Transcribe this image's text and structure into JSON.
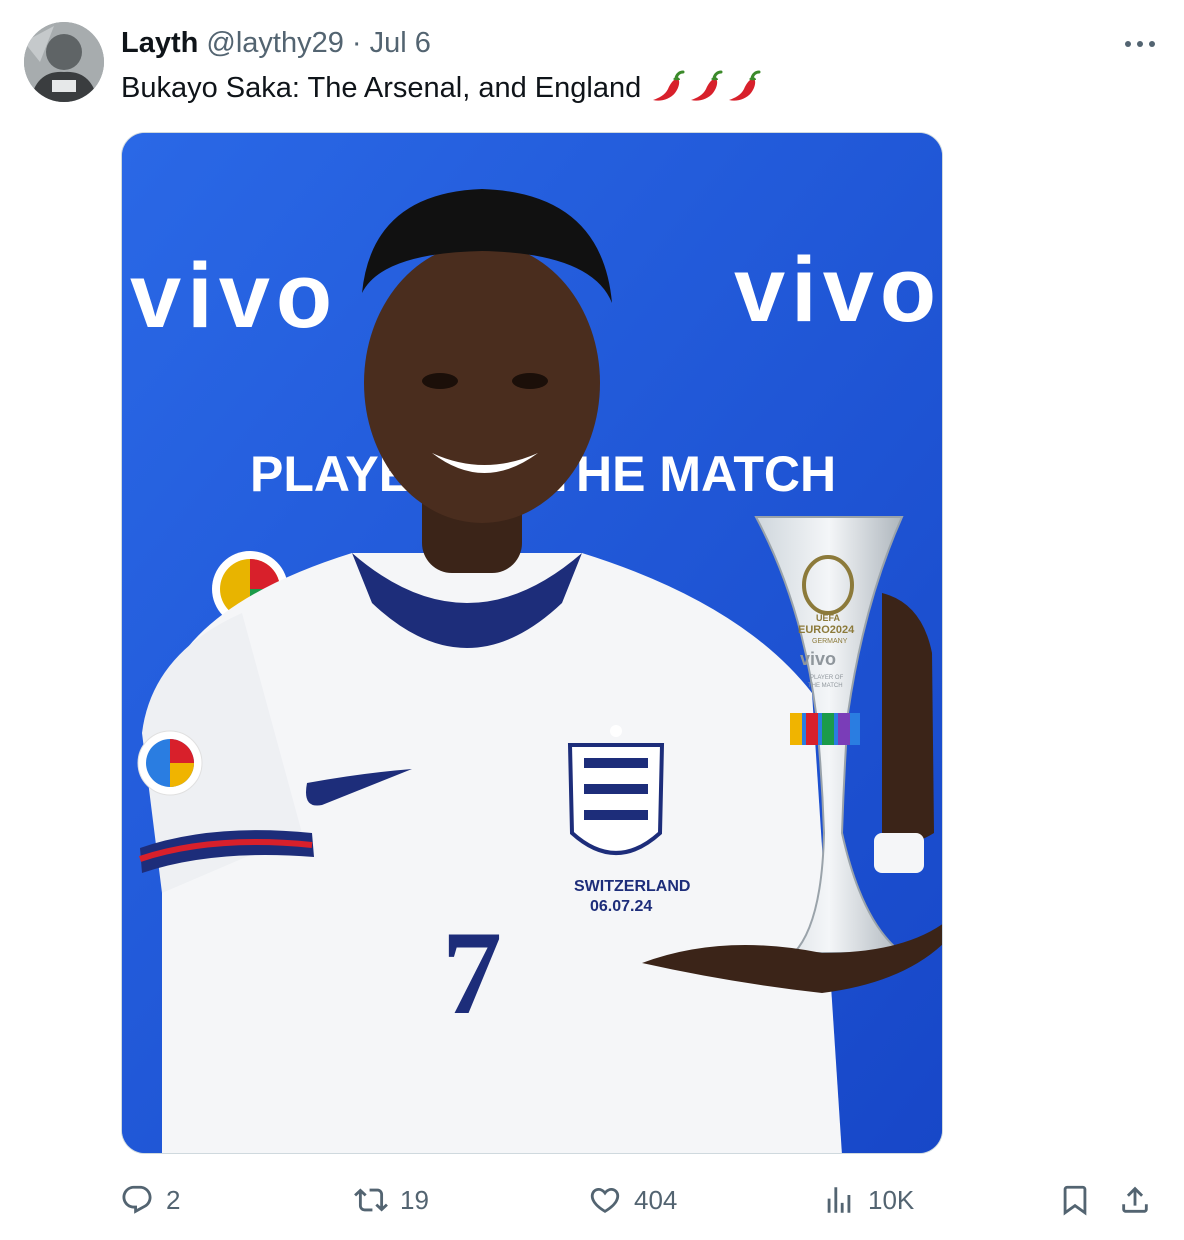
{
  "tweet": {
    "display_name": "Layth",
    "handle": "@laythy29",
    "separator": "·",
    "date": "Jul 6",
    "text": "Bukayo Saka: The Arsenal, and England",
    "emojis": [
      "hot-pepper-icon",
      "hot-pepper-icon",
      "hot-pepper-icon"
    ]
  },
  "media": {
    "backdrop_brand": "vivo",
    "backdrop_text": "PLAYER OF THE MATCH",
    "shirt_text": [
      "SWITZERLAND",
      "06.07.24"
    ],
    "shirt_number": "7",
    "trophy_text": [
      "UEFA",
      "EURO2024",
      "GERMANY",
      "vivo",
      "PLAYER OF",
      "THE MATCH"
    ]
  },
  "actions": {
    "replies": "2",
    "reposts": "19",
    "likes": "404",
    "views": "10K"
  },
  "colors": {
    "text_primary": "#0f1419",
    "text_secondary": "#536471",
    "border": "#cfd9de",
    "backdrop_blue": "#1f5fe0",
    "pepper_red": "#d8202b"
  },
  "icons": [
    "more-icon",
    "reply-icon",
    "repost-icon",
    "like-icon",
    "views-icon",
    "bookmark-icon",
    "share-icon"
  ]
}
